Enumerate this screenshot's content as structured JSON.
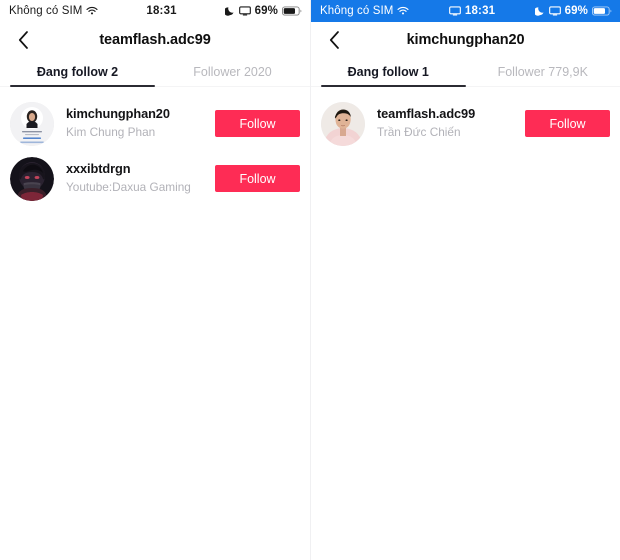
{
  "panels": [
    {
      "status": {
        "carrier": "Không có SIM",
        "wifi_icon": "wifi-icon",
        "time": "18:31",
        "dnd_icon": "moon-icon",
        "screen_icon": "screen-mirroring-icon",
        "battery_pct": "69%",
        "battery_icon": "battery-icon",
        "blue": false,
        "show_center_screen_icon": false
      },
      "nav": {
        "back_icon": "back-chevron-icon",
        "title": "teamflash.adc99"
      },
      "tabs": [
        {
          "label": "Đang follow 2",
          "active": true
        },
        {
          "label": "Follower 2020",
          "active": false
        }
      ],
      "users": [
        {
          "username": "kimchungphan20",
          "nickname": "Kim Chung Phan",
          "avatar": "avatar-certificate-photo",
          "follow_label": "Follow"
        },
        {
          "username": "xxxibtdrgn",
          "nickname": "Youtube:Daxua Gaming",
          "avatar": "avatar-dark-anime",
          "follow_label": "Follow"
        }
      ]
    },
    {
      "status": {
        "carrier": "Không có SIM",
        "wifi_icon": "wifi-icon",
        "time": "18:31",
        "dnd_icon": "moon-icon",
        "screen_icon": "screen-mirroring-icon",
        "battery_pct": "69%",
        "battery_icon": "battery-icon",
        "blue": true,
        "show_center_screen_icon": true
      },
      "nav": {
        "back_icon": "back-chevron-icon",
        "title": "kimchungphan20"
      },
      "tabs": [
        {
          "label": "Đang follow 1",
          "active": true
        },
        {
          "label": "Follower 779,9K",
          "active": false
        }
      ],
      "users": [
        {
          "username": "teamflash.adc99",
          "nickname": "Trần Đức Chiến",
          "avatar": "avatar-light-portrait",
          "follow_label": "Follow"
        }
      ]
    }
  ],
  "colors": {
    "accent": "#fe2c55",
    "status_blue": "#1579e8",
    "tab_active": "#161823",
    "tab_inactive": "#b8b8bd",
    "nickname": "#b2b2b8"
  }
}
